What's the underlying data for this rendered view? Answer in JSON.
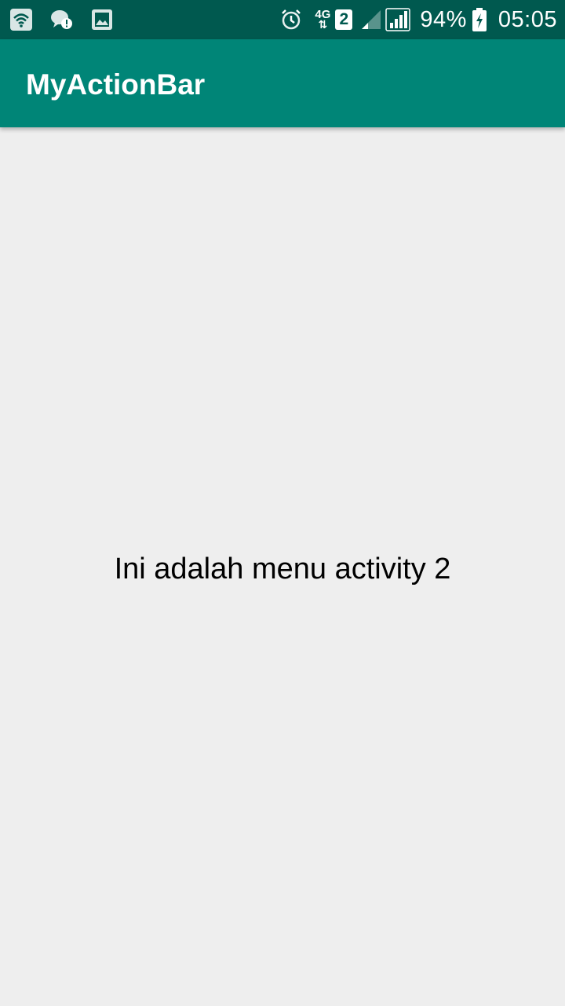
{
  "status_bar": {
    "left_icons": [
      "wifi-icon",
      "chat-alert-icon",
      "image-icon"
    ],
    "right_icons": [
      "alarm-icon",
      "network-4g-icon",
      "sim-2-icon",
      "signal-weak-icon",
      "signal-icon",
      "battery-charging-icon"
    ],
    "network_type": "4G",
    "sim_number": "2",
    "battery_percent": "94%",
    "time": "05:05",
    "background_color": "#00594f"
  },
  "app_bar": {
    "title": "MyActionBar",
    "background_color": "#008577"
  },
  "content": {
    "message": "Ini adalah menu activity 2",
    "background_color": "#eeeeee"
  }
}
